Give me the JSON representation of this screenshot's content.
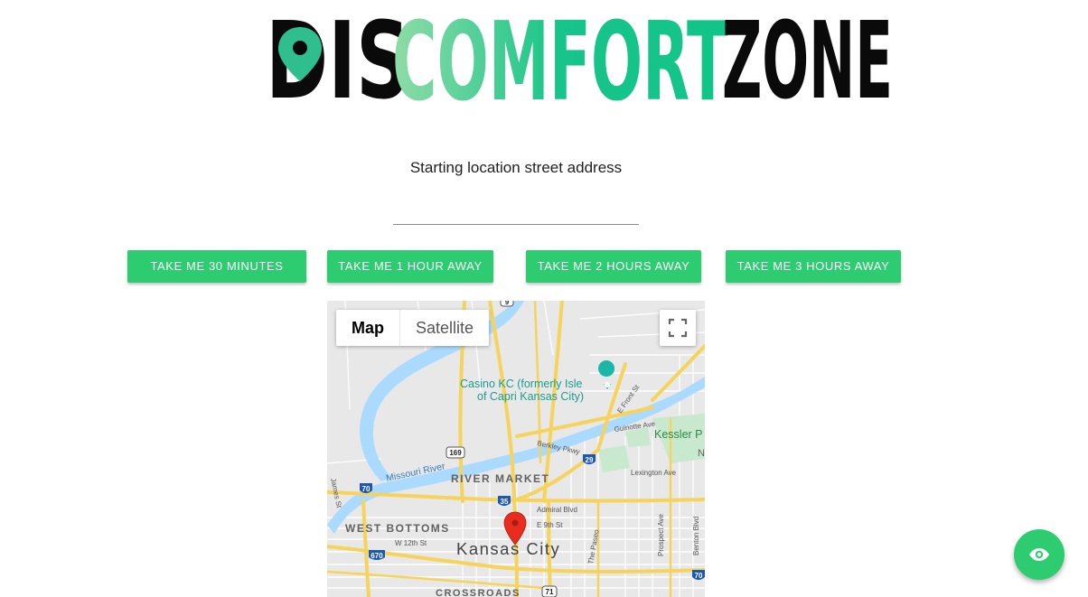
{
  "logo": {
    "text_dis": "DIS",
    "text_comfort": "COMFORT",
    "text_zone": "ZONE",
    "colors": {
      "dark": "#0a0a0a",
      "green_start": "#8fdca6",
      "green_end": "#12c487"
    }
  },
  "form": {
    "prompt": "Starting location street address",
    "address_value": "",
    "address_placeholder": ""
  },
  "buttons": [
    {
      "label": "TAKE ME 30 MINUTES"
    },
    {
      "label": "TAKE ME 1 HOUR AWAY"
    },
    {
      "label": "TAKE ME 2 HOURS AWAY"
    },
    {
      "label": "TAKE ME 3 HOURS AWAY"
    }
  ],
  "map": {
    "map_type": {
      "map": "Map",
      "satellite": "Satellite",
      "selected": "Map"
    },
    "fullscreen_icon": "fullscreen-icon",
    "marker_icon": "map-pin-icon",
    "labels": {
      "casino_line1": "Casino KC (formerly Isle",
      "casino_line2": "of Capri Kansas City)",
      "river_market": "RIVER MARKET",
      "missouri_river": "Missouri River",
      "berkley_pkwy": "Berkley Pkwy",
      "guinotte_ave": "Guinotte Ave",
      "e_front_st": "E Front St",
      "kessler": "Kessler P",
      "lexington_ave": "Lexington Ave",
      "west_bottoms": "WEST BOTTOMS",
      "w_12th_st": "W 12th St",
      "kansas_city": "Kansas City",
      "admiral_blvd": "Admiral Blvd",
      "e_9th_st": "E 9th St",
      "the_paseo": "The Paseo",
      "prospect_ave": "Prospect Ave",
      "benton_blvd": "Benton Blvd",
      "james_st": "James St",
      "crossroads": "CROSSROADS",
      "n_ka": "N KA"
    },
    "shields": {
      "i70": "70",
      "i670": "670",
      "i35": "35",
      "i29": "29",
      "us169": "169",
      "us71": "71",
      "us9": "9"
    },
    "colors": {
      "land": "#e8e8e8",
      "water": "#aadaff",
      "highway": "#f6d35c",
      "road": "#ffffff",
      "park": "#c9e9cf",
      "marker": "#ea2b1f",
      "poi": "#1ab6a6"
    }
  },
  "fab": {
    "icon": "eye-icon"
  },
  "accent": "#2ecc71"
}
